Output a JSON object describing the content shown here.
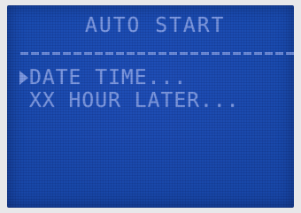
{
  "screen": {
    "title": "AUTO START",
    "menu_items": [
      {
        "label": "DATE TIME...",
        "selected": true
      },
      {
        "label": "XX HOUR LATER...",
        "selected": false
      }
    ]
  },
  "colors": {
    "background": "#1a4cb1",
    "text": "#7e9ae2"
  },
  "icons": {
    "selection_cursor": "right-triangle-pointer"
  }
}
